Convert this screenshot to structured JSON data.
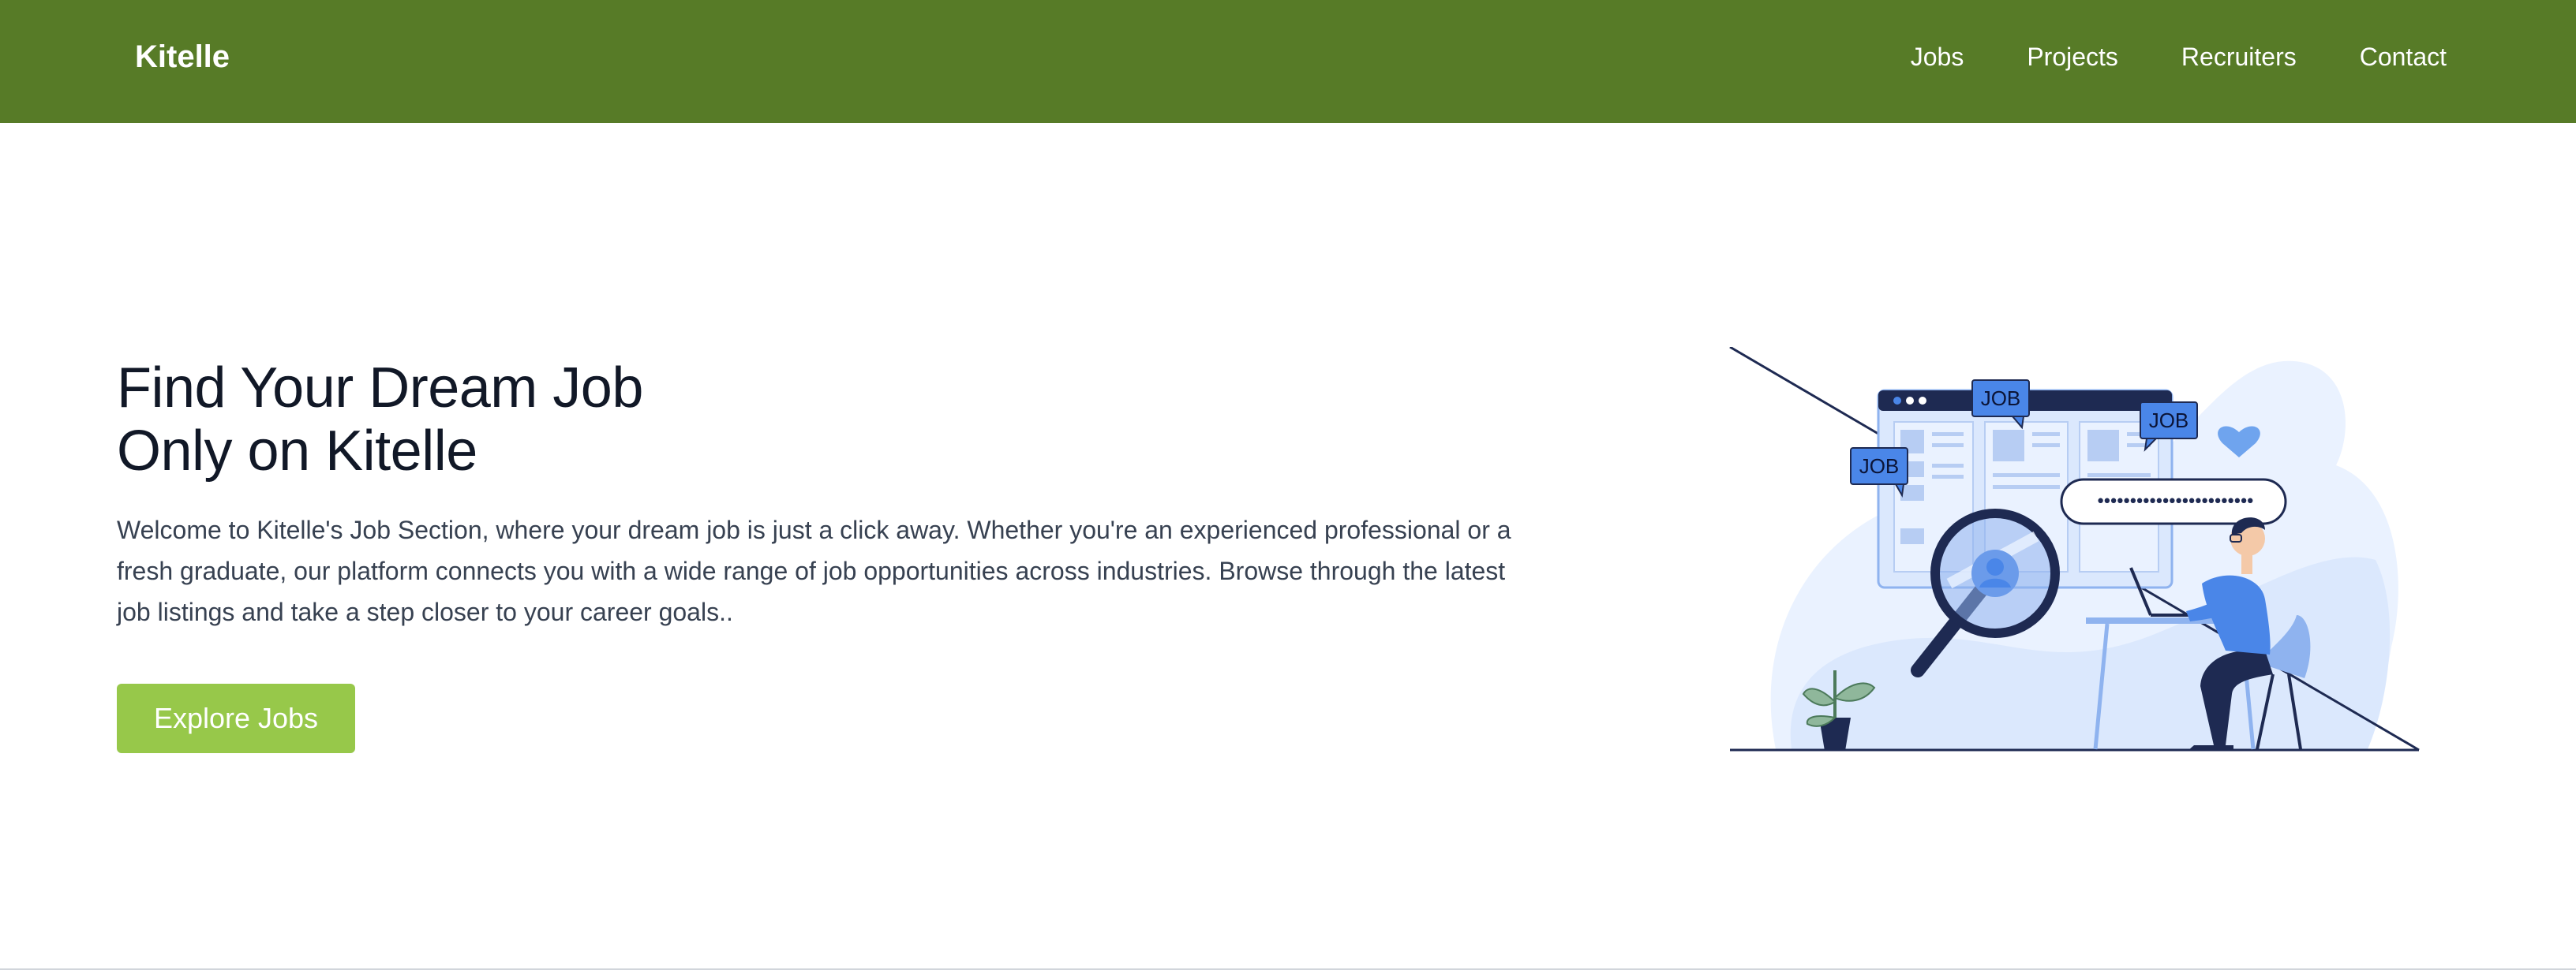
{
  "navbar": {
    "brand": "Kitelle",
    "links": [
      "Jobs",
      "Projects",
      "Recruiters",
      "Contact"
    ],
    "background": "#577b27"
  },
  "hero": {
    "title_line1": "Find Your Dream Job",
    "title_line2": "Only on Kitelle",
    "description": "Welcome to Kitelle's Job Section, where your dream job is just a click away. Whether you're an experienced professional or a fresh graduate, our platform connects you with a wide range of job opportunities across industries. Browse through the latest job listings and take a step closer to your career goals..",
    "cta_label": "Explore Jobs",
    "cta_color": "#97c84a"
  },
  "illustration": {
    "tags": [
      "JOB",
      "JOB",
      "JOB"
    ],
    "search_dots": "••••••••••••••••••••••••",
    "icons": [
      "job-search-illustration",
      "magnifier-icon",
      "heart-icon",
      "plant-icon",
      "person-at-laptop"
    ]
  }
}
